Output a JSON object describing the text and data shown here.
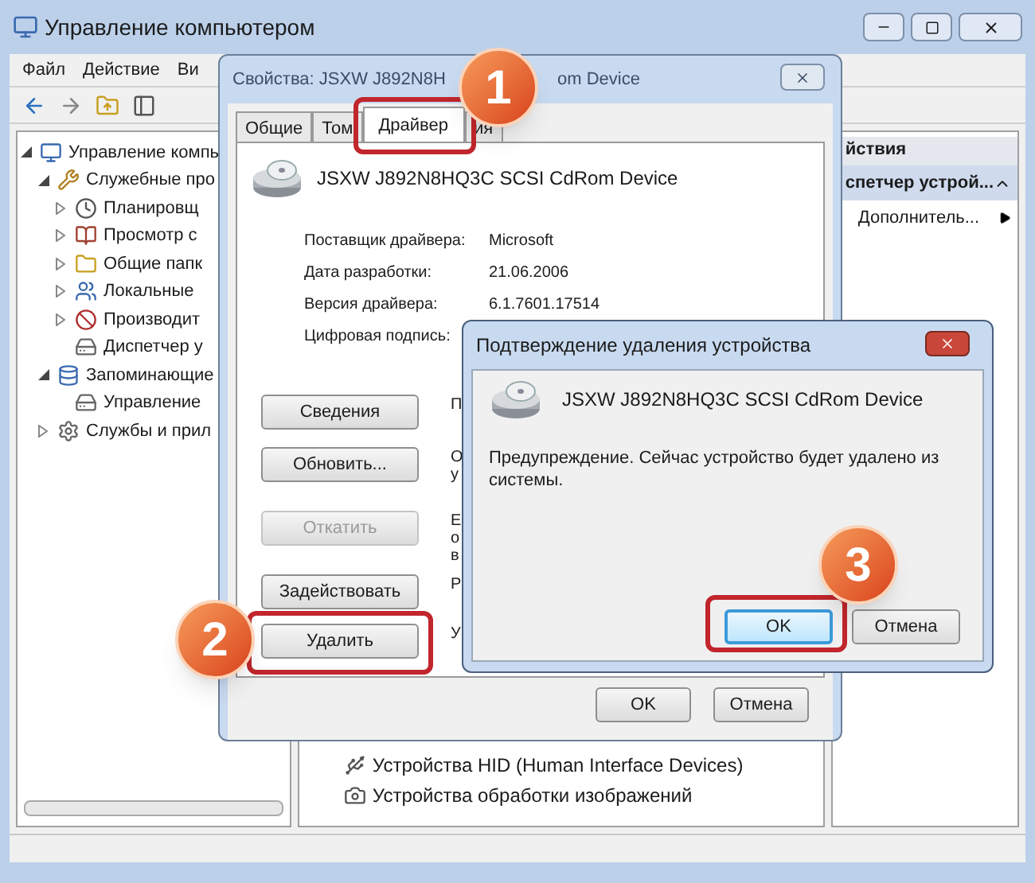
{
  "main_window": {
    "title": "Управление компьютером",
    "menu": [
      "Файл",
      "Действие",
      "Ви"
    ],
    "tree": [
      {
        "label": "Управление компь",
        "expanded": true,
        "children": [
          {
            "label": "Служебные про",
            "expanded": true,
            "children": [
              {
                "label": "Планировщ",
                "expanded": false
              },
              {
                "label": "Просмотр с",
                "expanded": false
              },
              {
                "label": "Общие папк",
                "expanded": false
              },
              {
                "label": "Локальные",
                "expanded": false
              },
              {
                "label": "Производит",
                "expanded": false
              },
              {
                "label": "Диспетчер у"
              }
            ]
          },
          {
            "label": "Запоминающие",
            "expanded": true,
            "children": [
              {
                "label": "Управление"
              }
            ]
          },
          {
            "label": "Службы и прил",
            "expanded": false
          }
        ]
      }
    ],
    "device_list": [
      {
        "label": "Устройства HID (Human Interface Devices)"
      },
      {
        "label": "Устройства обработки изображений"
      }
    ],
    "actions": {
      "header": "йствия",
      "items": [
        {
          "label": "спетчер устрой...",
          "selected": true
        },
        {
          "label": "Дополнитель...",
          "selected": false
        }
      ]
    }
  },
  "properties_dialog": {
    "title_start": "Свойства: JSXW J892N8H",
    "title_end": "om Device",
    "tabs": [
      {
        "label": "Общие",
        "selected": false
      },
      {
        "label": "Том",
        "selected": false
      },
      {
        "label": "Драйвер",
        "selected": true
      },
      {
        "label": "ия",
        "selected": false
      }
    ],
    "device_name": "JSXW J892N8HQ3C SCSI CdRom Device",
    "properties": [
      {
        "label": "Поставщик драйвера:",
        "value": "Microsoft"
      },
      {
        "label": "Дата разработки:",
        "value": "21.06.2006"
      },
      {
        "label": "Версия драйвера:",
        "value": "6.1.7601.17514"
      },
      {
        "label": "Цифровая подпись:"
      }
    ],
    "actions": [
      {
        "label": "Сведения",
        "disabled": false,
        "description": [
          "П"
        ]
      },
      {
        "label": "Обновить...",
        "disabled": false,
        "description": [
          "О",
          "у"
        ]
      },
      {
        "label": "Откатить",
        "disabled": true,
        "description": [
          "Е",
          "о",
          "в"
        ]
      },
      {
        "label": "Задействовать",
        "disabled": false,
        "description": [
          "Р"
        ]
      },
      {
        "label": "Удалить",
        "disabled": false,
        "description": [
          "У"
        ]
      }
    ],
    "buttons": [
      "OK",
      "Отмена"
    ]
  },
  "confirm_dialog": {
    "title": "Подтверждение удаления устройства",
    "device_name": "JSXW J892N8HQ3C SCSI CdRom Device",
    "message": "Предупреждение. Сейчас устройство будет удалено из системы.",
    "buttons": [
      {
        "label": "OK",
        "selected": true
      },
      {
        "label": "Отмена",
        "selected": false
      }
    ]
  },
  "step_badges": [
    "1",
    "2",
    "3"
  ]
}
